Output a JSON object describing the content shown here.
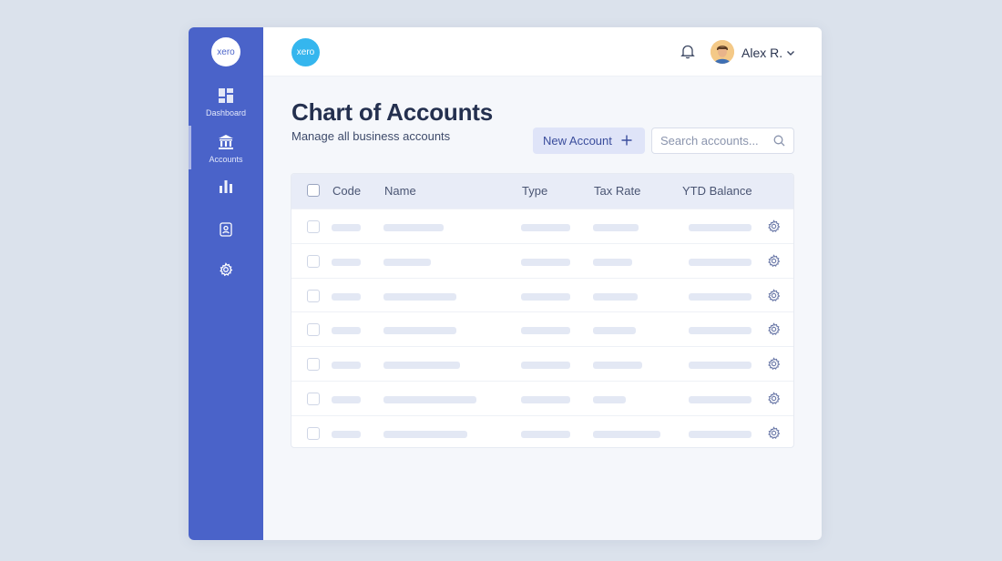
{
  "sidebar": {
    "logo_text": "xero",
    "items": [
      {
        "label": "Dashboard",
        "icon": "dashboard-icon"
      },
      {
        "label": "Accounts",
        "icon": "bank-icon",
        "active": true
      },
      {
        "label": "",
        "icon": "bar-chart-icon"
      },
      {
        "label": "",
        "icon": "contact-card-icon"
      },
      {
        "label": "",
        "icon": "gear-icon"
      }
    ]
  },
  "topbar": {
    "logo_text": "xero",
    "user_name": "Alex R."
  },
  "page": {
    "title": "Chart of Accounts",
    "subtitle": "Manage all business accounts",
    "new_account_label": "New Account",
    "search_placeholder": "Search accounts..."
  },
  "table": {
    "columns": [
      "Code",
      "Name",
      "Type",
      "Tax Rate",
      "YTD Balance"
    ],
    "row_count": 7,
    "rows_loading": true
  },
  "colors": {
    "sidebar": "#4a63c9",
    "accent": "#35b6ee",
    "button_bg": "#dfe4f8"
  }
}
